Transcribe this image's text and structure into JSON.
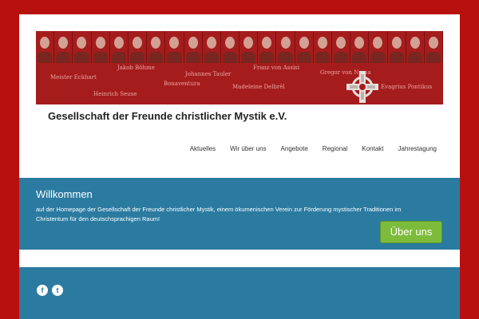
{
  "banner": {
    "names": [
      "Meister Eckhart",
      "Jakob Böhme",
      "Heinrich Seuse",
      "Bonaventura",
      "Johannes Tauler",
      "Madeleine Delbrêl",
      "Franz von Assisi",
      "Gregor von Nyssa",
      "Evagrius Pontikus"
    ]
  },
  "header": {
    "site_title": "Gesellschaft der Freunde christlicher  Mystik e.V."
  },
  "nav": {
    "items": [
      "Aktuelles",
      "Wir über uns",
      "Angebote",
      "Regional",
      "Kontakt",
      "Jahrestagung"
    ]
  },
  "welcome": {
    "title": "Willkommen",
    "text": "auf der Homepage der Gesellschaft der Freunde christlicher Mystik, einem ökumenischen Verein zur Förderung mystischer Traditionen im Christentum für den deutschsprachigen Raum!",
    "button": "Über uns"
  },
  "footer": {
    "facebook_glyph": "f",
    "twitter_glyph": "t"
  },
  "colors": {
    "frame": "#b80f0f",
    "banner": "#a51c1c",
    "accent": "#2b7ba1",
    "cta": "#7dbb3a"
  }
}
